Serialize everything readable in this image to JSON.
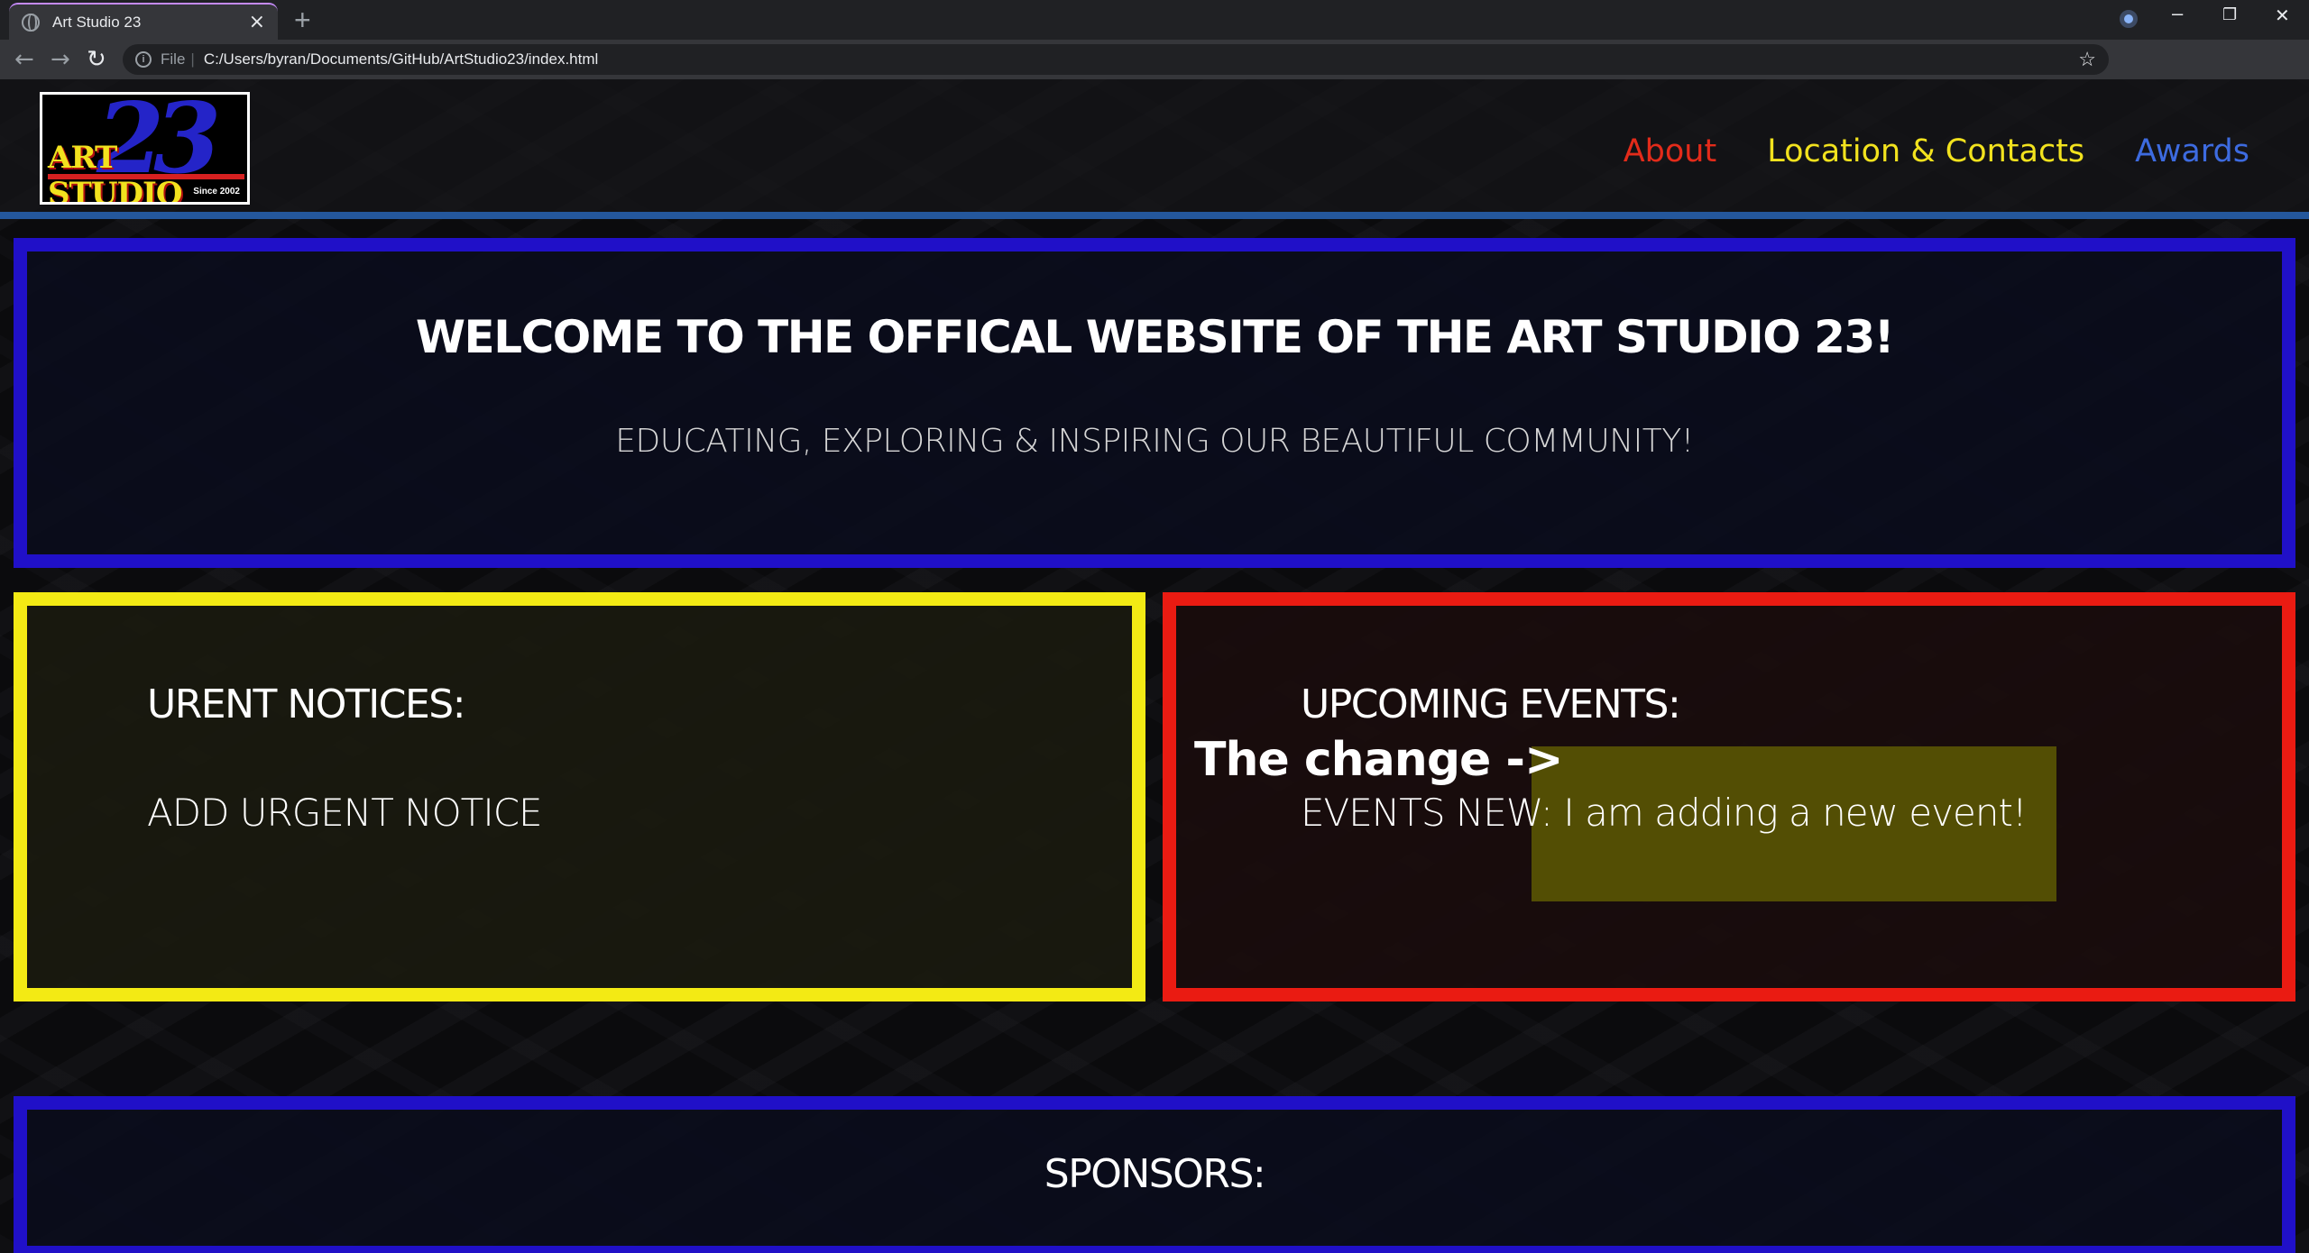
{
  "browser": {
    "tab_title": "Art Studio 23",
    "tab_close": "×",
    "new_tab": "+",
    "url_scheme": "File",
    "url_separator": "|",
    "url": "C:/Users/byran/Documents/GitHub/ArtStudio23/index.html",
    "window_controls": {
      "minimize": "–",
      "restore": "❐",
      "close": "✕"
    }
  },
  "header": {
    "logo": {
      "number": "23",
      "wordmark": "ART STUDIO",
      "since": "Since 2002"
    },
    "nav": [
      {
        "label": "About",
        "color": "#e32b1a"
      },
      {
        "label": "Location & Contacts",
        "color": "#f2e21e"
      },
      {
        "label": "Awards",
        "color": "#3d6be0"
      }
    ],
    "rule_color": "#24579c"
  },
  "welcome": {
    "title": "WELCOME TO THE OFFICAL WEBSITE OF THE ART STUDIO 23!",
    "subtitle": "EDUCATING, EXPLORING & INSPIRING OUR BEAUTIFUL COMMUNITY!",
    "border_color": "#2010c8"
  },
  "urgent": {
    "heading": "URENT NOTICES:",
    "body": "ADD URGENT NOTICE",
    "border_color": "#f3ea14"
  },
  "events": {
    "heading": "UPCOMING EVENTS:",
    "change_label": "The change ->",
    "body": "EVENTS NEW: I am adding a new event!",
    "border_color": "#ea1b12"
  },
  "sponsors": {
    "heading": "SPONSORS:",
    "border_color": "#2010c8"
  }
}
